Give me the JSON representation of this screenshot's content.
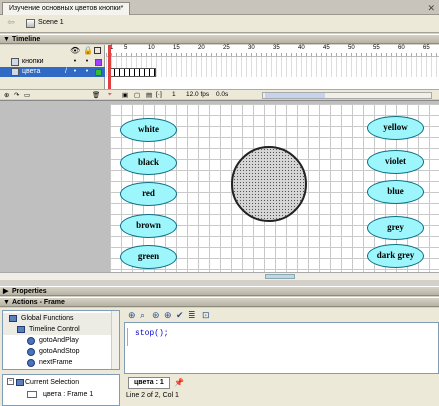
{
  "document": {
    "tab_title": "Изучение основных цветов кнопки*",
    "close_glyph": "✕"
  },
  "scene": {
    "label": "Scene 1",
    "back_glyph": "⇦"
  },
  "timeline": {
    "title": "Timeline",
    "layers": [
      {
        "name": "кнопки"
      },
      {
        "name": "цвета"
      }
    ],
    "ruler_numbers": [
      "1",
      "5",
      "10",
      "15",
      "20",
      "25",
      "30",
      "35",
      "40",
      "45",
      "50",
      "55",
      "60",
      "65"
    ],
    "current_frame": "1",
    "fps": "12.0 fps",
    "time": "0.0s"
  },
  "stage": {
    "left_buttons": [
      "white",
      "black",
      "red",
      "brown",
      "green"
    ],
    "right_buttons": [
      "yellow",
      "violet",
      "blue",
      "grey",
      "dark grey"
    ],
    "button_fill": "#9df6fb",
    "button_stroke": "#0d6f86"
  },
  "properties": {
    "title": "Properties"
  },
  "actions": {
    "title": "Actions - Frame",
    "tree": [
      {
        "label": "Global Functions",
        "kind": "book",
        "indent": 0
      },
      {
        "label": "Timeline Control",
        "kind": "book",
        "indent": 1
      },
      {
        "label": "gotoAndPlay",
        "kind": "fn",
        "indent": 2
      },
      {
        "label": "gotoAndStop",
        "kind": "fn",
        "indent": 2
      },
      {
        "label": "nextFrame",
        "kind": "fn",
        "indent": 2
      }
    ],
    "selection": [
      {
        "label": "Current Selection"
      },
      {
        "label": "цвета : Frame 1"
      }
    ],
    "code": "stop();",
    "script_tab": "цвета : 1",
    "status": "Line 2 of 2, Col 1"
  }
}
